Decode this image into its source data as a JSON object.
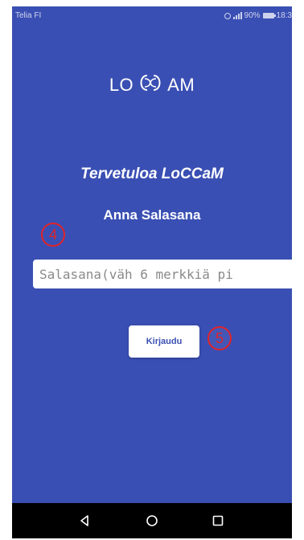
{
  "status_bar": {
    "carrier": "Telia FI",
    "indicators": "⏰ ⁴G 90%",
    "time": "18:3",
    "icons": [
      "alarm-icon",
      "signal-icon",
      "battery-icon"
    ]
  },
  "logo": {
    "text_left": "LO",
    "text_right": "AM",
    "mark_icon": "loccam-logo-mark-icon"
  },
  "welcome_title": "Tervetuloa LoCCaM",
  "prompt": "Anna Salasana",
  "password": {
    "value": "",
    "placeholder": "Salasana(väh 6 merkkiä pi"
  },
  "login_button_label": "Kirjaudu",
  "annotations": {
    "step_4": "4",
    "step_5": "5"
  },
  "nav_bar": {
    "icons": [
      "back-icon",
      "home-icon",
      "recent-apps-icon"
    ]
  },
  "colors": {
    "background": "#3a4fb3",
    "marker": "#e0242b",
    "nav_bar": "#000000"
  }
}
